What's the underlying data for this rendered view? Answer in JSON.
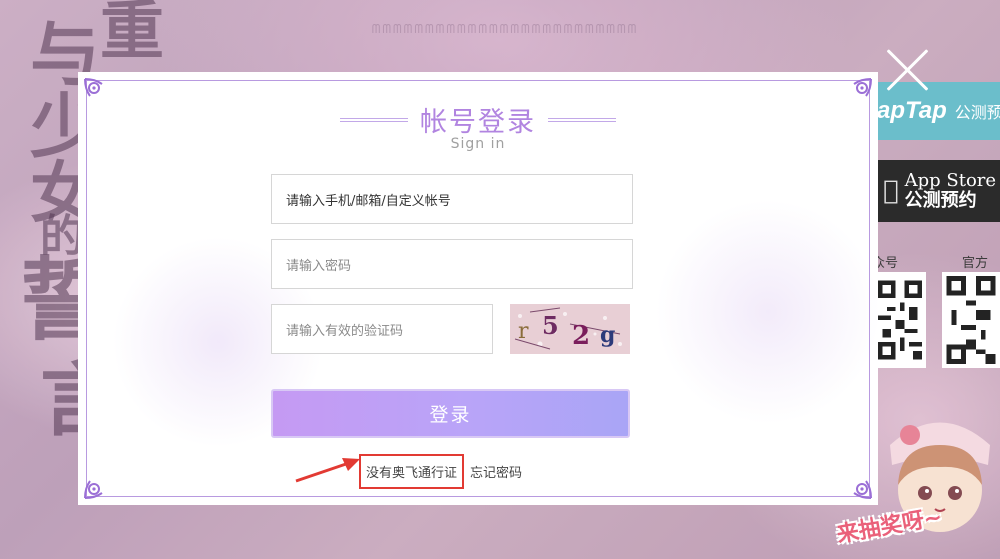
{
  "background": {
    "title_chars": [
      "与",
      "重",
      "少",
      "女",
      "的",
      "誓",
      "言"
    ],
    "strip_text": "ᗰᗰᗰᗰᗰᗰᗰᗰᗰᗰᗰᗰᗰᗰᗰᗰᗰᗰᗰᗰᗰᗰᗰᗰᗰ",
    "taptap": {
      "brand": "apTap",
      "sub": "公测预"
    },
    "appstore": {
      "line1": "App Store",
      "line2": "公测预约"
    },
    "qr_labels": [
      "众号",
      "官方微"
    ],
    "raffle_text": "来抽奖呀~"
  },
  "modal": {
    "title": "帐号登录",
    "subtitle": "Sign in",
    "account_value": "请输入手机/邮箱/自定义帐号",
    "password_placeholder": "请输入密码",
    "captcha_placeholder": "请输入有效的验证码",
    "captcha_text": [
      "r",
      "5",
      "2",
      "g"
    ],
    "login_label": "登录",
    "register_link": "没有奥飞通行证",
    "forgot_link": "忘记密码"
  },
  "colors": {
    "accent": "#b184e0",
    "button_start": "#c59af3",
    "button_end": "#a9a5f6",
    "highlight": "#e23a33"
  }
}
